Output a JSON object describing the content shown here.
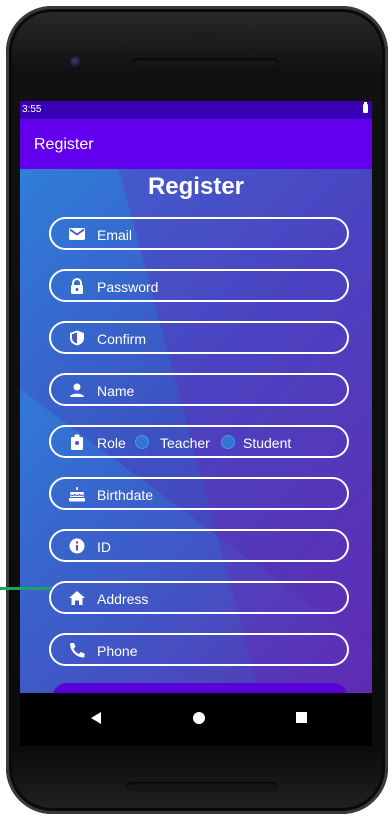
{
  "status_bar": {
    "time": "3:55"
  },
  "app_bar": {
    "title": "Register"
  },
  "page": {
    "title": "Register"
  },
  "fields": {
    "email": "Email",
    "password": "Password",
    "confirm": "Confirm",
    "name": "Name",
    "role": "Role",
    "role_options": [
      "Teacher",
      "Student"
    ],
    "birthdate": "Birthdate",
    "id": "ID",
    "address": "Address",
    "phone": "Phone"
  },
  "colors": {
    "status_bar": "#3a00b5",
    "app_bar": "#6200ee",
    "accent_line": "#19a462"
  },
  "icons": [
    "envelope-icon",
    "lock-icon",
    "shield-icon",
    "person-icon",
    "badge-icon",
    "cake-icon",
    "info-icon",
    "home-icon",
    "phone-icon"
  ]
}
